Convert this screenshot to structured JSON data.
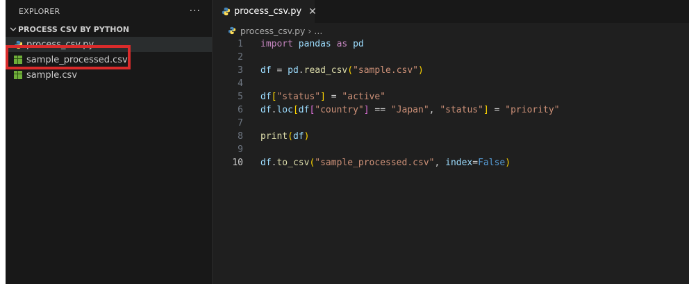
{
  "explorer": {
    "title": "EXPLORER",
    "more_actions": "···",
    "project": "PROCESS CSV BY PYTHON",
    "files": [
      {
        "name": "process_csv.py",
        "type": "python"
      },
      {
        "name": "sample_processed.csv",
        "type": "csv"
      },
      {
        "name": "sample.csv",
        "type": "csv"
      }
    ]
  },
  "editor": {
    "tab": {
      "label": "process_csv.py",
      "close": "✕"
    },
    "breadcrumb": {
      "file": "process_csv.py",
      "separator": "›",
      "more": "..."
    },
    "line_numbers": [
      "1",
      "2",
      "3",
      "4",
      "5",
      "6",
      "7",
      "8",
      "9",
      "10"
    ],
    "code": {
      "l1_kw": "import",
      "l1_mod": "pandas",
      "l1_as": "as",
      "l1_alias": "pd",
      "l3_var": "df",
      "l3_eq": " = ",
      "l3_mod": "pd",
      "l3_dot": ".",
      "l3_fn": "read_csv",
      "l3_open": "(",
      "l3_str": "\"sample.csv\"",
      "l3_close": ")",
      "l5_var": "df",
      "l5_open": "[",
      "l5_key": "\"status\"",
      "l5_close": "]",
      "l5_eq": " = ",
      "l5_val": "\"active\"",
      "l6_var": "df",
      "l6_dot": ".",
      "l6_attr": "loc",
      "l6_open": "[",
      "l6_df": "df",
      "l6_open2": "[",
      "l6_key": "\"country\"",
      "l6_close2": "]",
      "l6_eq": " == ",
      "l6_val": "\"Japan\"",
      "l6_comma": ", ",
      "l6_key2": "\"status\"",
      "l6_close": "]",
      "l6_assign": " = ",
      "l6_val2": "\"priority\"",
      "l8_fn": "print",
      "l8_open": "(",
      "l8_arg": "df",
      "l8_close": ")",
      "l10_var": "df",
      "l10_dot": ".",
      "l10_fn": "to_csv",
      "l10_open": "(",
      "l10_str": "\"sample_processed.csv\"",
      "l10_comma": ", ",
      "l10_kw": "index",
      "l10_eq": "=",
      "l10_const": "False",
      "l10_close": ")"
    }
  },
  "colors": {
    "highlight_box": "#d92b2b",
    "csv_icon": "#6fae3a"
  }
}
